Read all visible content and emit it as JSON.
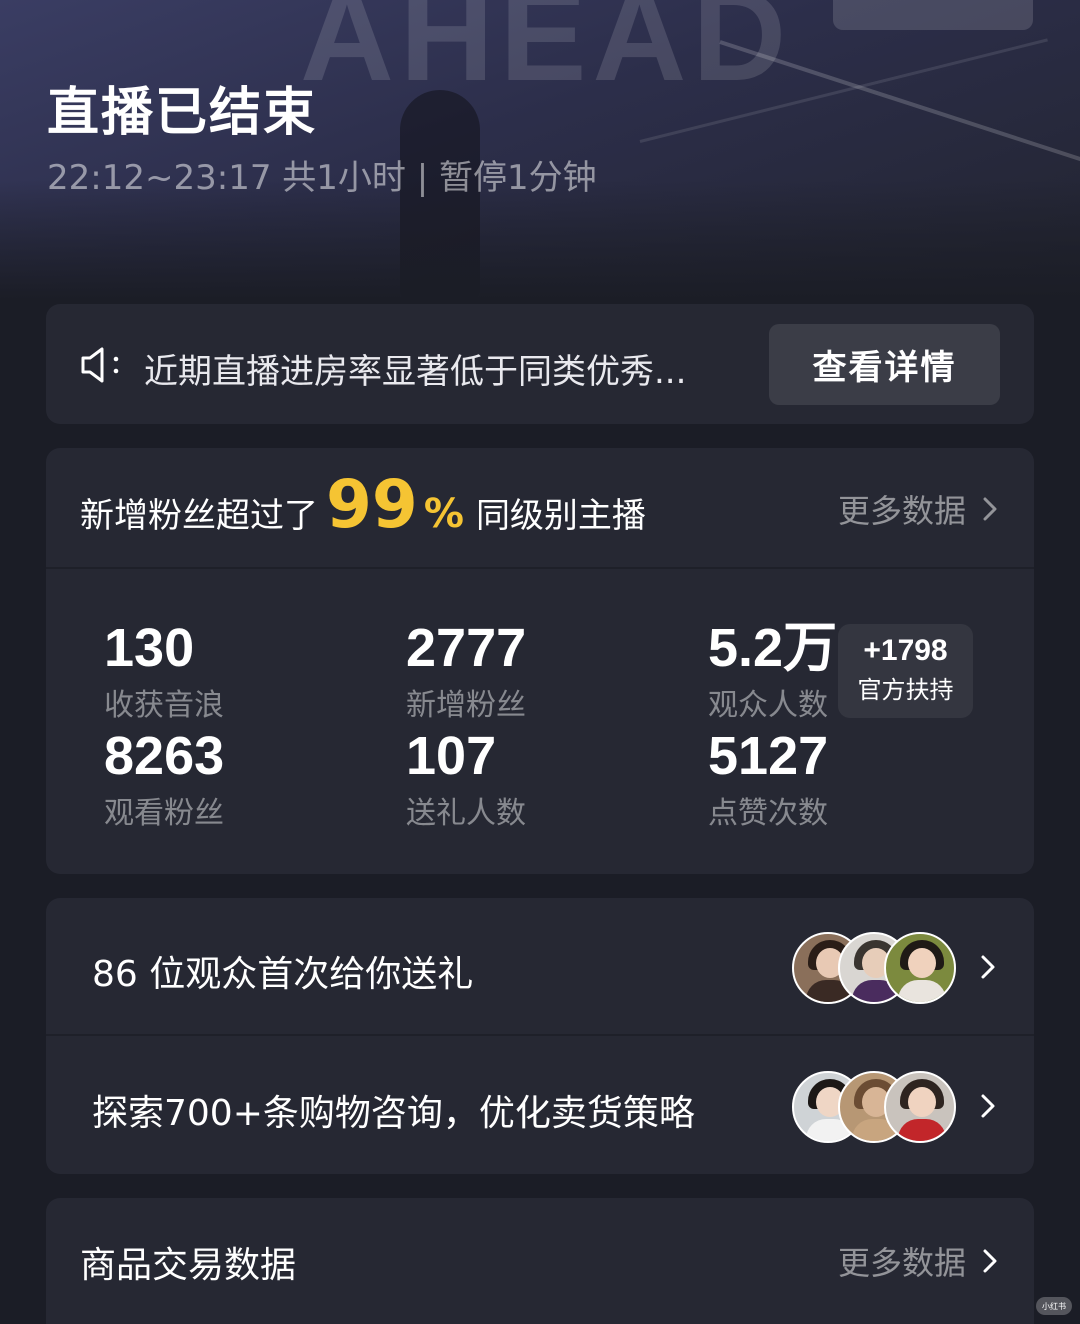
{
  "header": {
    "title": "直播已结束",
    "subtitle": "22:12~23:17 共1小时 | 暂停1分钟",
    "background_text": "AHEAD"
  },
  "notice": {
    "text": "近期直播进房率显著低于同类优秀...",
    "button_label": "查看详情",
    "icon": "speaker-icon"
  },
  "fans_summary": {
    "prefix": "新增粉丝超过了",
    "percent_value": "99",
    "percent_symbol": "%",
    "suffix": "同级别主播",
    "more_label": "更多数据",
    "accent_color": "#f5c433"
  },
  "metrics": [
    {
      "value": "130",
      "label": "收获音浪"
    },
    {
      "value": "2777",
      "label": "新增粉丝"
    },
    {
      "value": "5.2万",
      "label": "观众人数"
    },
    {
      "value": "8263",
      "label": "观看粉丝"
    },
    {
      "value": "107",
      "label": "送礼人数"
    },
    {
      "value": "5127",
      "label": "点赞次数"
    }
  ],
  "support_badge": {
    "value": "+1798",
    "label": "官方扶持"
  },
  "list": [
    {
      "label": "86 位观众首次给你送礼"
    },
    {
      "label": "探索700+条购物咨询，优化卖货策略"
    }
  ],
  "trade": {
    "label": "商品交易数据",
    "more_label": "更多数据"
  },
  "watermark": "小红书"
}
